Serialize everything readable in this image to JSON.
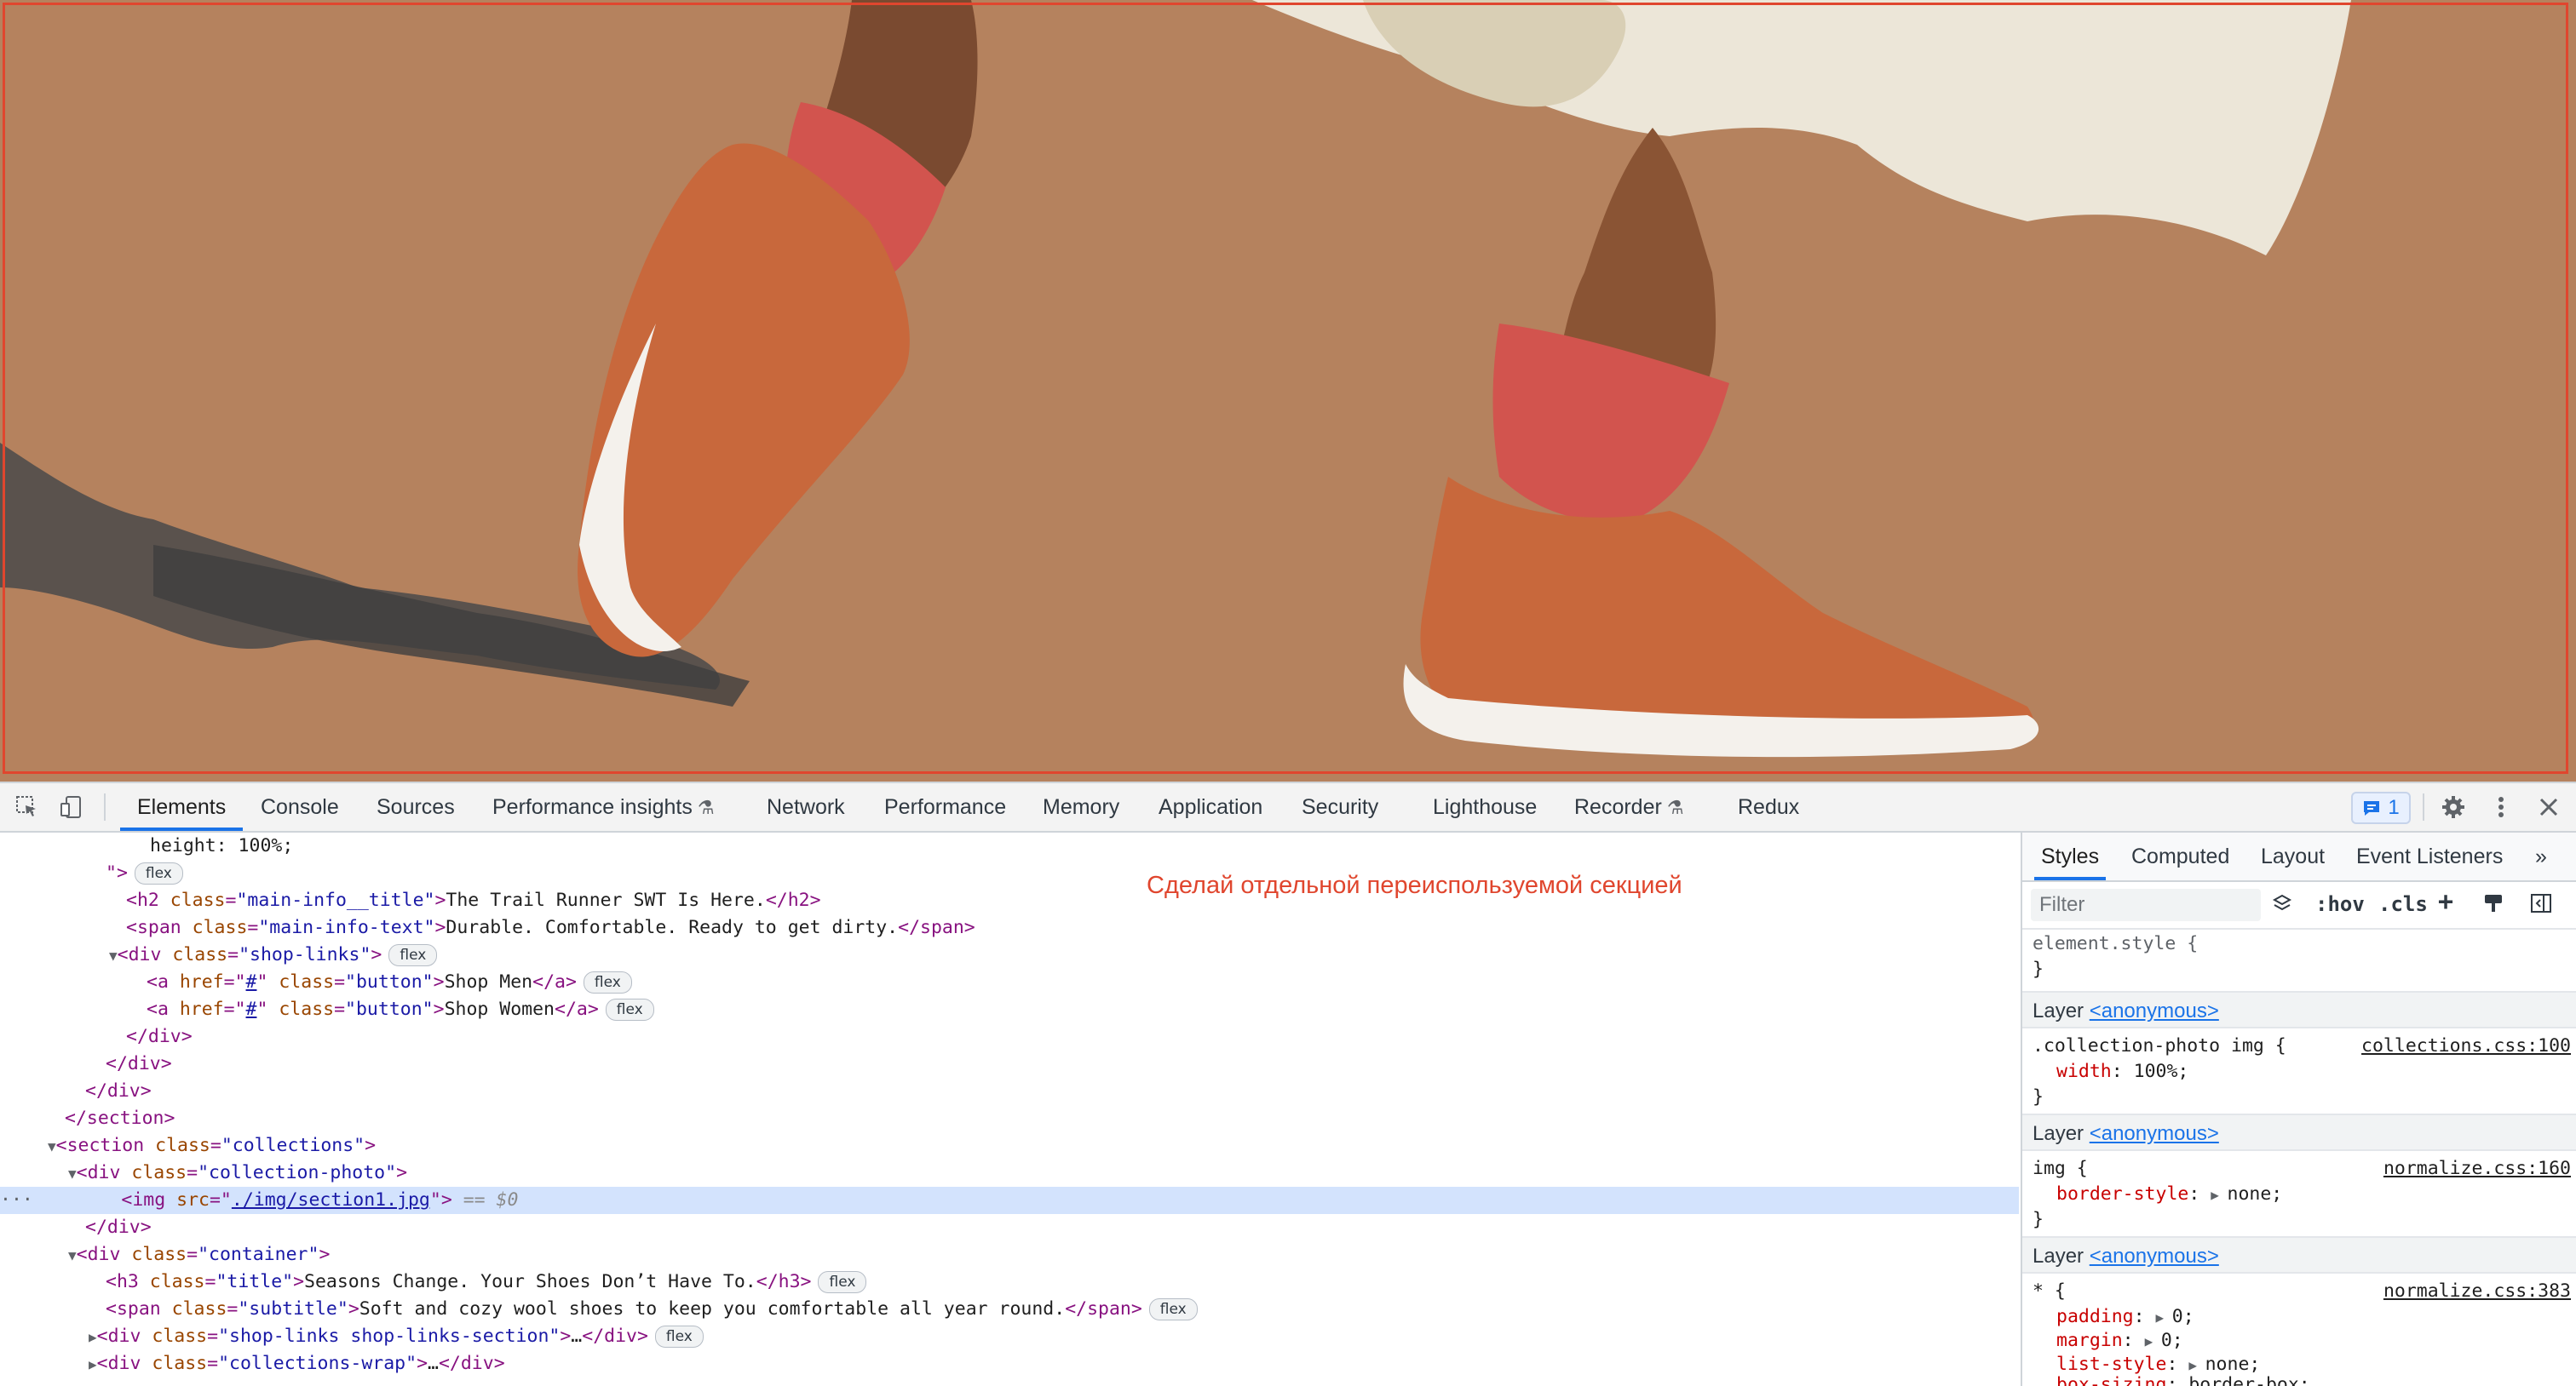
{
  "page": {
    "image_alt": "Two feet in orange wool sneakers with red socks on a tan background",
    "annotation": "Сделай отдельной переиспользуемой секцией"
  },
  "devtools": {
    "tabs": [
      "Elements",
      "Console",
      "Sources",
      "Performance insights",
      "Network",
      "Performance",
      "Memory",
      "Application",
      "Security",
      "Lighthouse",
      "Recorder",
      "Redux"
    ],
    "active_tab": "Elements",
    "issues_count": "1",
    "elements_lines": [
      {
        "text_a": "height: 100%;"
      },
      {
        "text_a": "\">",
        "chip": "flex"
      },
      {
        "tag_open": "<h2 ",
        "attr": "class",
        "val": "\"main-info__title\"",
        "text": "The Trail Runner SWT Is Here.",
        "tag_close": "</h2>"
      },
      {
        "tag_open": "<span ",
        "attr": "class",
        "val": "\"main-info-text\"",
        "text": "Durable. Comfortable. Ready to get dirty.",
        "tag_close": "</span>"
      },
      {
        "tag_open": "<div ",
        "attr": "class",
        "val": "\"shop-links\"",
        "chip": "flex"
      },
      {
        "tag_open": "<a ",
        "attr": "href",
        "val_link": "#",
        "attr2": "class",
        "val2": "\"button\"",
        "text": "Shop Men",
        "tag_close": "</a>",
        "chip": "flex"
      },
      {
        "tag_open": "<a ",
        "attr": "href",
        "val_link": "#",
        "attr2": "class",
        "val2": "\"button\"",
        "text": "Shop Women",
        "tag_close": "</a>",
        "chip": "flex"
      },
      {
        "tag_close": "</div>"
      },
      {
        "tag_close": "</div>"
      },
      {
        "tag_close": "</div>"
      },
      {
        "tag_close": "</section>"
      },
      {
        "tag_open": "<section ",
        "attr": "class",
        "val": "\"collections\""
      },
      {
        "tag_open": "<div ",
        "attr": "class",
        "val": "\"collection-photo\""
      },
      {
        "tag_open": "<img ",
        "attr": "src",
        "val_link": "./img/section1.jpg",
        "eq": "== $0"
      },
      {
        "tag_close": "</div>"
      },
      {
        "tag_open": "<div ",
        "attr": "class",
        "val": "\"container\""
      },
      {
        "tag_open": "<h3 ",
        "attr": "class",
        "val": "\"title\"",
        "text": "Seasons Change. Your Shoes Don’t Have To.",
        "tag_close": "</h3>",
        "chip": "flex"
      },
      {
        "tag_open": "<span ",
        "attr": "class",
        "val": "\"subtitle\"",
        "text": "Soft and cozy wool shoes to keep you comfortable all year round.",
        "tag_close": "</span>",
        "chip": "flex"
      },
      {
        "tag_open": "<div ",
        "attr": "class",
        "val": "\"shop-links shop-links-section\"",
        "text": "…",
        "tag_close": "</div>",
        "chip": "flex"
      },
      {
        "tag_open": "<div ",
        "attr": "class",
        "val": "\"collections-wrap\"",
        "text": "…",
        "tag_close": "</div>"
      }
    ],
    "styles": {
      "tabs": [
        "Styles",
        "Computed",
        "Layout",
        "Event Listeners"
      ],
      "more": "»",
      "filter_placeholder": "Filter",
      "hov": ":hov",
      "cls": ".cls",
      "element_style": "element.style {",
      "close_brace": "}",
      "layer_label": "Layer",
      "layer_name": "<anonymous>",
      "rule1": {
        "selector": ".collection-photo img {",
        "source": "collections.css:100",
        "prop": "width",
        "value": "100%;"
      },
      "rule2": {
        "selector": "img {",
        "source": "normalize.css:160",
        "prop": "border-style",
        "value": "none;"
      },
      "rule3": {
        "selector": "* {",
        "source": "normalize.css:383",
        "props": [
          {
            "prop": "padding",
            "value": "0;"
          },
          {
            "prop": "margin",
            "value": "0;"
          },
          {
            "prop": "list-style",
            "value": "none;"
          },
          {
            "prop": "box-sizing",
            "value": "border-box;"
          }
        ]
      }
    }
  },
  "colors": {
    "highlight": "#e0462e",
    "accent": "#1a73e8",
    "background": "#b5825e"
  }
}
